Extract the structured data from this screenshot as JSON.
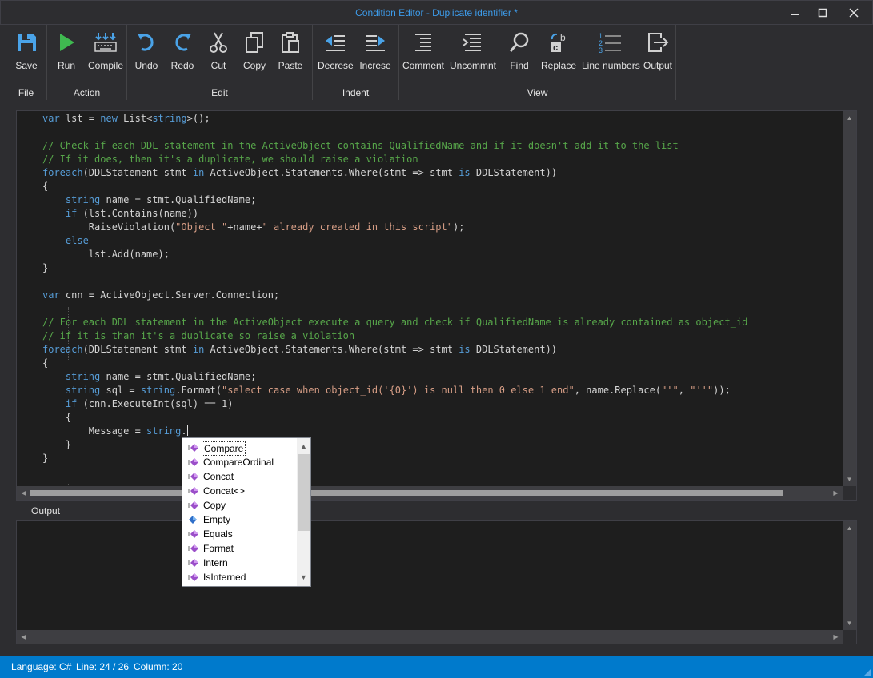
{
  "window": {
    "title": "Condition Editor - Duplicate identifier *",
    "controls": [
      "minimize-icon",
      "maximize-icon",
      "close-icon"
    ]
  },
  "ribbon": {
    "groups": [
      {
        "label": "File",
        "tools": [
          {
            "label": "Save",
            "icon": "save-icon"
          }
        ]
      },
      {
        "label": "Action",
        "tools": [
          {
            "label": "Run",
            "icon": "run-icon"
          },
          {
            "label": "Compile",
            "icon": "compile-icon"
          }
        ]
      },
      {
        "label": "Edit",
        "tools": [
          {
            "label": "Undo",
            "icon": "undo-icon"
          },
          {
            "label": "Redo",
            "icon": "redo-icon"
          },
          {
            "label": "Cut",
            "icon": "cut-icon"
          },
          {
            "label": "Copy",
            "icon": "copy-icon"
          },
          {
            "label": "Paste",
            "icon": "paste-icon"
          }
        ]
      },
      {
        "label": "Indent",
        "tools": [
          {
            "label": "Decrese",
            "icon": "decrease-indent-icon"
          },
          {
            "label": "Increse",
            "icon": "increase-indent-icon"
          }
        ]
      },
      {
        "label": "View",
        "tools": [
          {
            "label": "Comment",
            "icon": "comment-icon"
          },
          {
            "label": "Uncommnt",
            "icon": "uncomment-icon"
          },
          {
            "label": "Find",
            "icon": "find-icon"
          },
          {
            "label": "Replace",
            "icon": "replace-icon"
          },
          {
            "label": "Line numbers",
            "icon": "line-numbers-icon"
          },
          {
            "label": "Output",
            "icon": "output-icon"
          }
        ]
      }
    ]
  },
  "editor": {
    "lines": [
      "var lst = new List<string>();",
      "",
      "// Check if each DDL statement in the ActiveObject contains QualifiedName and if it doesn't add it to the list",
      "// If it does, then it's a duplicate, we should raise a violation",
      "foreach(DDLStatement stmt in ActiveObject.Statements.Where(stmt => stmt is DDLStatement))",
      "{",
      "    string name = stmt.QualifiedName;",
      "    if (lst.Contains(name))",
      "        RaiseViolation(\"Object \"+name+\" already created in this script\");",
      "    else",
      "        lst.Add(name);",
      "}",
      "",
      "var cnn = ActiveObject.Server.Connection;",
      "",
      "// For each DDL statement in the ActiveObject execute a query and check if QualifiedName is already contained as object_id",
      "// if it is than it's a duplicate so raise a violation",
      "foreach(DDLStatement stmt in ActiveObject.Statements.Where(stmt => stmt is DDLStatement))",
      "{",
      "    string name = stmt.QualifiedName;",
      "    string sql = string.Format(\"select case when object_id('{0}') is null then 0 else 1 end\", name.Replace(\"'\", \"''\"));",
      "    if (cnn.ExecuteInt(sql) == 1)",
      "    {",
      "        Message = string.",
      "    }",
      "}"
    ]
  },
  "output": {
    "label": "Output",
    "content": ""
  },
  "autocomplete": {
    "items": [
      {
        "label": "Compare",
        "icon": "method-icon",
        "selected": true
      },
      {
        "label": "CompareOrdinal",
        "icon": "method-icon"
      },
      {
        "label": "Concat",
        "icon": "method-icon"
      },
      {
        "label": "Concat<>",
        "icon": "method-icon"
      },
      {
        "label": "Copy",
        "icon": "method-icon"
      },
      {
        "label": "Empty",
        "icon": "field-icon"
      },
      {
        "label": "Equals",
        "icon": "method-icon"
      },
      {
        "label": "Format",
        "icon": "method-icon"
      },
      {
        "label": "Intern",
        "icon": "method-icon"
      },
      {
        "label": "IsInterned",
        "icon": "method-icon"
      }
    ]
  },
  "status": {
    "language": "Language: C#",
    "line": "Line: 24 / 26",
    "column": "Column: 20"
  },
  "colors": {
    "accent": "#007acc",
    "keyword": "#569cd6",
    "comment": "#57a64a",
    "string": "#d69d85",
    "title": "#3d9be9"
  }
}
